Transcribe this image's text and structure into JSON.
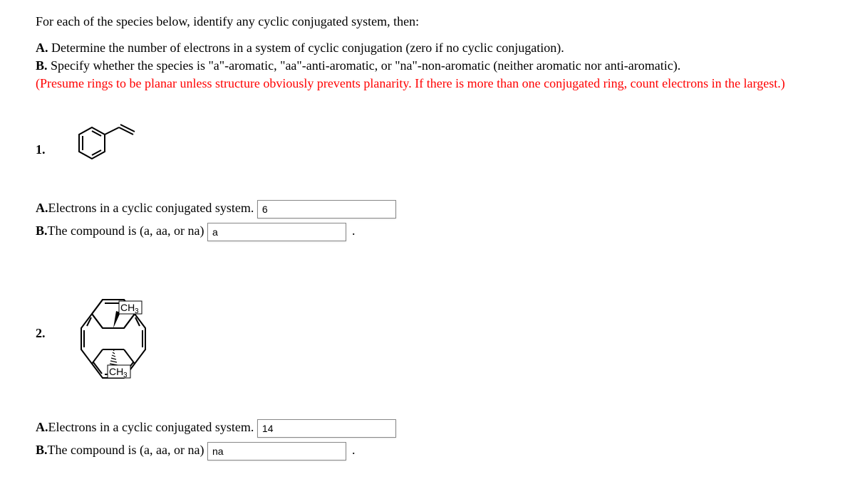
{
  "intro": "For each of the species below, identify any cyclic conjugated system, then:",
  "partA_label": "A.",
  "partA_text": " Determine the number of electrons in a system of cyclic conjugation (zero if no cyclic conjugation).",
  "partB_label": "B.",
  "partB_text": " Specify whether the species is \"a\"-aromatic, \"aa\"-anti-aromatic, or \"na\"-non-aromatic (neither aromatic nor anti-aromatic).",
  "presume_text": "(Presume rings to be planar unless structure obviously prevents planarity. If there is more than one conjugated ring, count electrons in the largest.)",
  "problem1": {
    "number": "1.",
    "answerA_label": "A.",
    "answerA_text": "Electrons in a cyclic conjugated system.",
    "answerA_value": "6",
    "answerB_label": "B.",
    "answerB_text": "The compound is (a, aa, or na)",
    "answerB_value": "a"
  },
  "problem2": {
    "number": "2.",
    "ch3_label_top": "CH",
    "ch3_sub_top": "3",
    "ch3_label_bot": "CH",
    "ch3_sub_bot": "3",
    "answerA_label": "A.",
    "answerA_text": "Electrons in a cyclic conjugated system.",
    "answerA_value": "14",
    "answerB_label": "B.",
    "answerB_text": "The compound is (a, aa, or na)",
    "answerB_value": "na"
  }
}
